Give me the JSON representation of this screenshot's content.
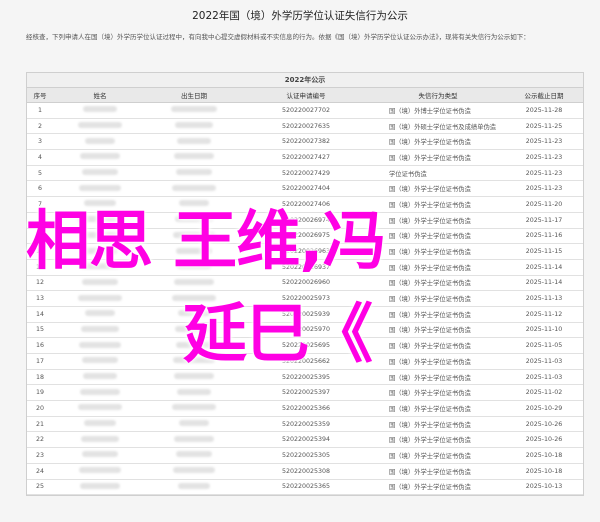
{
  "title": "2022年国（境）外学历学位认证失信行为公示",
  "intro": "经核查，下列申请人在国（境）外学历学位认证过程中，有向我中心提交虚假材料或不实信息的行为。依据《国（境）外学历学位认证公示办法》，现将有关失信行为公示如下：",
  "table": {
    "caption": "2022年公示",
    "headers": [
      "序号",
      "姓名",
      "出生日期",
      "认证申请编号",
      "失信行为类型",
      "公示截止日期"
    ],
    "rows": [
      {
        "no": "1",
        "id": "520220027702",
        "type": "国（境）外博士学位证书伪造",
        "date": "2025-11-28"
      },
      {
        "no": "2",
        "id": "520220027635",
        "type": "国（境）外硕士学位证书及成绩单伪造",
        "date": "2025-11-25"
      },
      {
        "no": "3",
        "id": "520220027382",
        "type": "国（境）外学士学位证书伪造",
        "date": "2025-11-23"
      },
      {
        "no": "4",
        "id": "520220027427",
        "type": "国（境）外学士学位证书伪造",
        "date": "2025-11-23"
      },
      {
        "no": "5",
        "id": "520220027429",
        "type": "学位证书伪造",
        "date": "2025-11-23"
      },
      {
        "no": "6",
        "id": "520220027404",
        "type": "国（境）外学士学位证书伪造",
        "date": "2025-11-23"
      },
      {
        "no": "7",
        "id": "520220027406",
        "type": "国（境）外学士学位证书伪造",
        "date": "2025-11-20"
      },
      {
        "no": "8",
        "id": "520220026974",
        "type": "国（境）外学士学位证书伪造",
        "date": "2025-11-17"
      },
      {
        "no": "9",
        "id": "520220026975",
        "type": "国（境）外学士学位证书伪造",
        "date": "2025-11-16"
      },
      {
        "no": "10",
        "id": "520220026963",
        "type": "国（境）外学士学位证书伪造",
        "date": "2025-11-15"
      },
      {
        "no": "11",
        "id": "520220026937",
        "type": "国（境）外学士学位证书伪造",
        "date": "2025-11-14"
      },
      {
        "no": "12",
        "id": "520220026960",
        "type": "国（境）外学士学位证书伪造",
        "date": "2025-11-14"
      },
      {
        "no": "13",
        "id": "520220025973",
        "type": "国（境）外学士学位证书伪造",
        "date": "2025-11-13"
      },
      {
        "no": "14",
        "id": "520220025939",
        "type": "国（境）外学士学位证书伪造",
        "date": "2025-11-12"
      },
      {
        "no": "15",
        "id": "520220025970",
        "type": "国（境）外学士学位证书伪造",
        "date": "2025-11-10"
      },
      {
        "no": "16",
        "id": "520220025695",
        "type": "国（境）外学士学位证书伪造",
        "date": "2025-11-05"
      },
      {
        "no": "17",
        "id": "520220025662",
        "type": "国（境）外学士学位证书伪造",
        "date": "2025-11-03"
      },
      {
        "no": "18",
        "id": "520220025395",
        "type": "国（境）外学士学位证书伪造",
        "date": "2025-11-03"
      },
      {
        "no": "19",
        "id": "520220025397",
        "type": "国（境）外学士学位证书伪造",
        "date": "2025-11-02"
      },
      {
        "no": "20",
        "id": "520220025366",
        "type": "国（境）外学士学位证书伪造",
        "date": "2025-10-29"
      },
      {
        "no": "21",
        "id": "520220025359",
        "type": "国（境）外学士学位证书伪造",
        "date": "2025-10-26"
      },
      {
        "no": "22",
        "id": "520220025394",
        "type": "国（境）外学士学位证书伪造",
        "date": "2025-10-26"
      },
      {
        "no": "23",
        "id": "520220025305",
        "type": "国（境）外学士学位证书伪造",
        "date": "2025-10-18"
      },
      {
        "no": "24",
        "id": "520220025308",
        "type": "国（境）外学士学位证书伪造",
        "date": "2025-10-18"
      },
      {
        "no": "25",
        "id": "520220025365",
        "type": "国（境）外学士学位证书伪造",
        "date": "2025-10-13"
      }
    ]
  },
  "overlay": {
    "line1": "相思 王维,冯",
    "line2": "延巳《"
  }
}
